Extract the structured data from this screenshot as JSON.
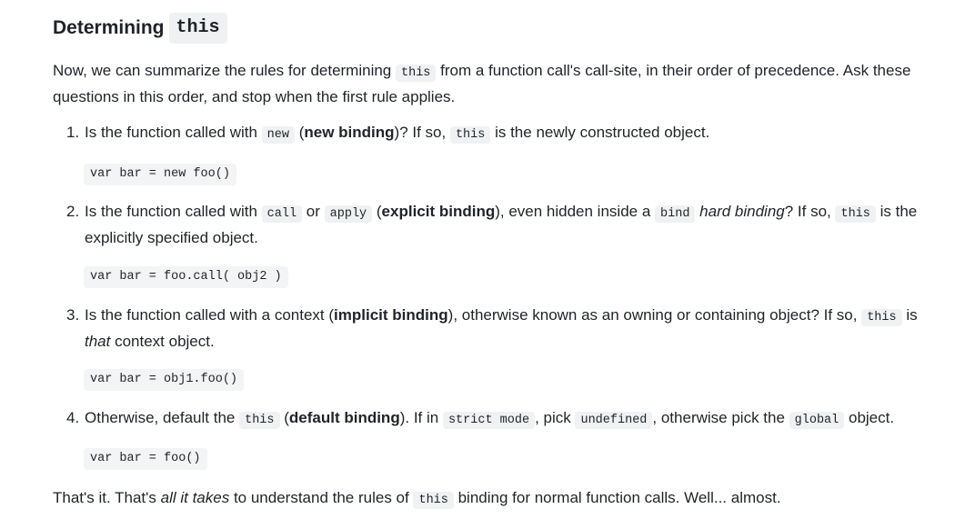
{
  "heading": {
    "text": "Determining",
    "code": "this"
  },
  "intro": {
    "t1": "Now, we can summarize the rules for determining ",
    "c1": "this",
    "t2": " from a function call's call-site, in their order of precedence. Ask these questions in this order, and stop when the first rule applies."
  },
  "rules": [
    {
      "num": "1.",
      "t1": "Is the function called with ",
      "c1": "new",
      "t2": " (",
      "b1": "new binding",
      "t3": ")? If so, ",
      "c2": "this",
      "t4": " is the newly constructed object.",
      "code": "var bar = new foo()"
    },
    {
      "num": "2.",
      "t1": "Is the function called with ",
      "c1": "call",
      "t2": " or ",
      "c2": "apply",
      "t3": " (",
      "b1": "explicit binding",
      "t4": "), even hidden inside a ",
      "c3": "bind",
      "t5": " ",
      "i1": "hard binding",
      "t6": "? If so, ",
      "c4": "this",
      "t7": " is the explicitly specified object.",
      "code": "var bar = foo.call( obj2 )"
    },
    {
      "num": "3.",
      "t1": "Is the function called with a context (",
      "b1": "implicit binding",
      "t2": "), otherwise known as an owning or containing object? If so, ",
      "c1": "this",
      "t3": " is ",
      "i1": "that",
      "t4": " context object.",
      "code": "var bar = obj1.foo()"
    },
    {
      "num": "4.",
      "t1": "Otherwise, default the ",
      "c1": "this",
      "t2": " (",
      "b1": "default binding",
      "t3": "). If in ",
      "c2": "strict mode",
      "t4": ", pick ",
      "c3": "undefined",
      "t5": ", otherwise pick the ",
      "c4": "global",
      "t6": " object.",
      "code": "var bar = foo()"
    }
  ],
  "outro": {
    "t1": "That's it. That's ",
    "i1": "all it takes",
    "t2": " to understand the rules of ",
    "c1": "this",
    "t3": " binding for normal function calls. Well... almost."
  }
}
